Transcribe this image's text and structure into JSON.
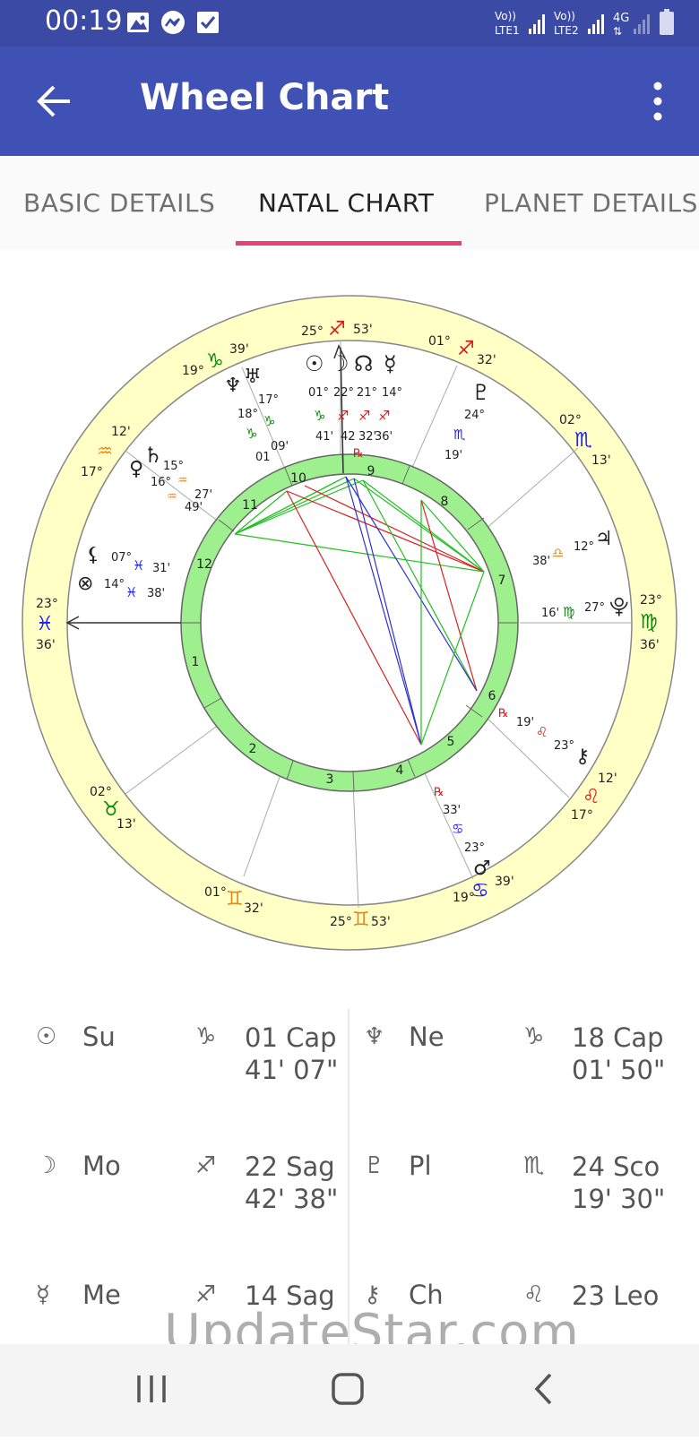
{
  "status_bar": {
    "time": "00:19",
    "left_icons": [
      "image-icon",
      "messenger-icon",
      "checkbox-icon"
    ],
    "sim1": "Vo)) LTE1",
    "sim2": "Vo)) LTE2",
    "network": "4G"
  },
  "app_bar": {
    "title": "Wheel Chart"
  },
  "tabs": [
    {
      "label": "BASIC DETAILS",
      "active": false
    },
    {
      "label": "NATAL CHART",
      "active": true
    },
    {
      "label": "PLANET DETAILS",
      "active": false
    }
  ],
  "colors": {
    "status_bar": "#3a4aa5",
    "app_bar": "#3f51b5",
    "tab_indicator": "#e8407a",
    "zodiac_ring": "#ffffc6",
    "house_ring": "#9ef08e"
  },
  "wheel": {
    "house_numbers": [
      "1",
      "2",
      "3",
      "4",
      "5",
      "6",
      "7",
      "8",
      "9",
      "10",
      "11",
      "12"
    ],
    "cusps": [
      {
        "sign": "♓",
        "deg": "23°",
        "min": "36'",
        "color": "#1a1aff"
      },
      {
        "sign": "♉",
        "deg": "02°",
        "min": "13'",
        "color": "#0a8a0a"
      },
      {
        "sign": "♊",
        "deg": "01°",
        "min": "32'",
        "color": "#e38a1e"
      },
      {
        "sign": "♊",
        "deg": "25°",
        "min": "53'",
        "color": "#e38a1e"
      },
      {
        "sign": "♋",
        "deg": "19°",
        "min": "39'",
        "color": "#1a1aff"
      },
      {
        "sign": "♌",
        "deg": "17°",
        "min": "12'",
        "color": "#d81c1c"
      },
      {
        "sign": "♍",
        "deg": "23°",
        "min": "36'",
        "color": "#0a8a0a"
      },
      {
        "sign": "♏",
        "deg": "02°",
        "min": "13'",
        "color": "#1a1aff"
      },
      {
        "sign": "♐",
        "deg": "01°",
        "min": "32'",
        "color": "#d81c1c"
      },
      {
        "sign": "♐",
        "deg": "25°",
        "min": "53'",
        "color": "#d81c1c"
      },
      {
        "sign": "♑",
        "deg": "19°",
        "min": "39'",
        "color": "#0a8a0a"
      },
      {
        "sign": "♒",
        "deg": "17°",
        "min": "12'",
        "color": "#e38a1e"
      }
    ],
    "planets": [
      {
        "glyph": "☉",
        "deg": "01°",
        "sign": "♑",
        "min": "41'",
        "sign_color": "#0a8a0a"
      },
      {
        "glyph": "☽",
        "deg": "22°",
        "sign": "♐",
        "min": "42",
        "sign_color": "#d81c1c"
      },
      {
        "glyph": "☊",
        "deg": "21°",
        "sign": "♐",
        "min": "32'",
        "sign_color": "#d81c1c"
      },
      {
        "glyph": "☿",
        "deg": "14°",
        "sign": "♐",
        "min": "36'",
        "sign_color": "#d81c1c"
      },
      {
        "glyph": "♆",
        "deg": "18°",
        "sign": "♑",
        "min": "01",
        "sign_color": "#0a8a0a"
      },
      {
        "glyph": "♅",
        "deg": "17°",
        "sign": "♑",
        "min": "09'",
        "sign_color": "#0a8a0a"
      },
      {
        "glyph": "♇",
        "deg": "24°",
        "sign": "♏",
        "min": "19'",
        "sign_color": "#1a1aff"
      },
      {
        "glyph": "♄",
        "deg": "15°",
        "sign": "♒",
        "min": "27'",
        "sign_color": "#e38a1e"
      },
      {
        "glyph": "♀",
        "deg": "16°",
        "sign": "♒",
        "min": "49'",
        "sign_color": "#e38a1e"
      },
      {
        "glyph": "⚸",
        "deg": "07°",
        "sign": "♓",
        "min": "31'",
        "sign_color": "#1a1aff"
      },
      {
        "glyph": "⊗",
        "deg": "14°",
        "sign": "♓",
        "min": "38'",
        "sign_color": "#1a1aff"
      },
      {
        "glyph": "♃",
        "deg": "12°",
        "sign": "♎",
        "min": "38'",
        "sign_color": "#e38a1e"
      },
      {
        "glyph": "⚷",
        "deg": "23°",
        "sign": "♌",
        "min": "19'",
        "sign_color": "#d81c1c"
      },
      {
        "glyph": "♂",
        "deg": "23°",
        "sign": "♋",
        "min": "33'",
        "sign_color": "#1a1aff"
      },
      {
        "glyph": "⯓",
        "deg": "27°",
        "sign": "♍",
        "min": "16'",
        "sign_color": "#0a8a0a"
      }
    ],
    "retrograde_symbol": "℞"
  },
  "planet_table": [
    {
      "glyph": "☉",
      "abbr": "Su",
      "sign_glyph": "♑",
      "pos_line1": "01 Cap",
      "pos_line2": "41' 07\""
    },
    {
      "glyph": "♆",
      "abbr": "Ne",
      "sign_glyph": "♑",
      "pos_line1": "18 Cap",
      "pos_line2": "01' 50\""
    },
    {
      "glyph": "☽",
      "abbr": "Mo",
      "sign_glyph": "♐",
      "pos_line1": "22 Sag",
      "pos_line2": "42' 38\""
    },
    {
      "glyph": "♇",
      "abbr": "Pl",
      "sign_glyph": "♏",
      "pos_line1": "24 Sco",
      "pos_line2": "19' 30\""
    },
    {
      "glyph": "☿",
      "abbr": "Me",
      "sign_glyph": "♐",
      "pos_line1": "14 Sag",
      "pos_line2": ""
    },
    {
      "glyph": "⚷",
      "abbr": "Ch",
      "sign_glyph": "♌",
      "pos_line1": "23 Leo",
      "pos_line2": ""
    }
  ],
  "watermark": "UpdateStar.com"
}
